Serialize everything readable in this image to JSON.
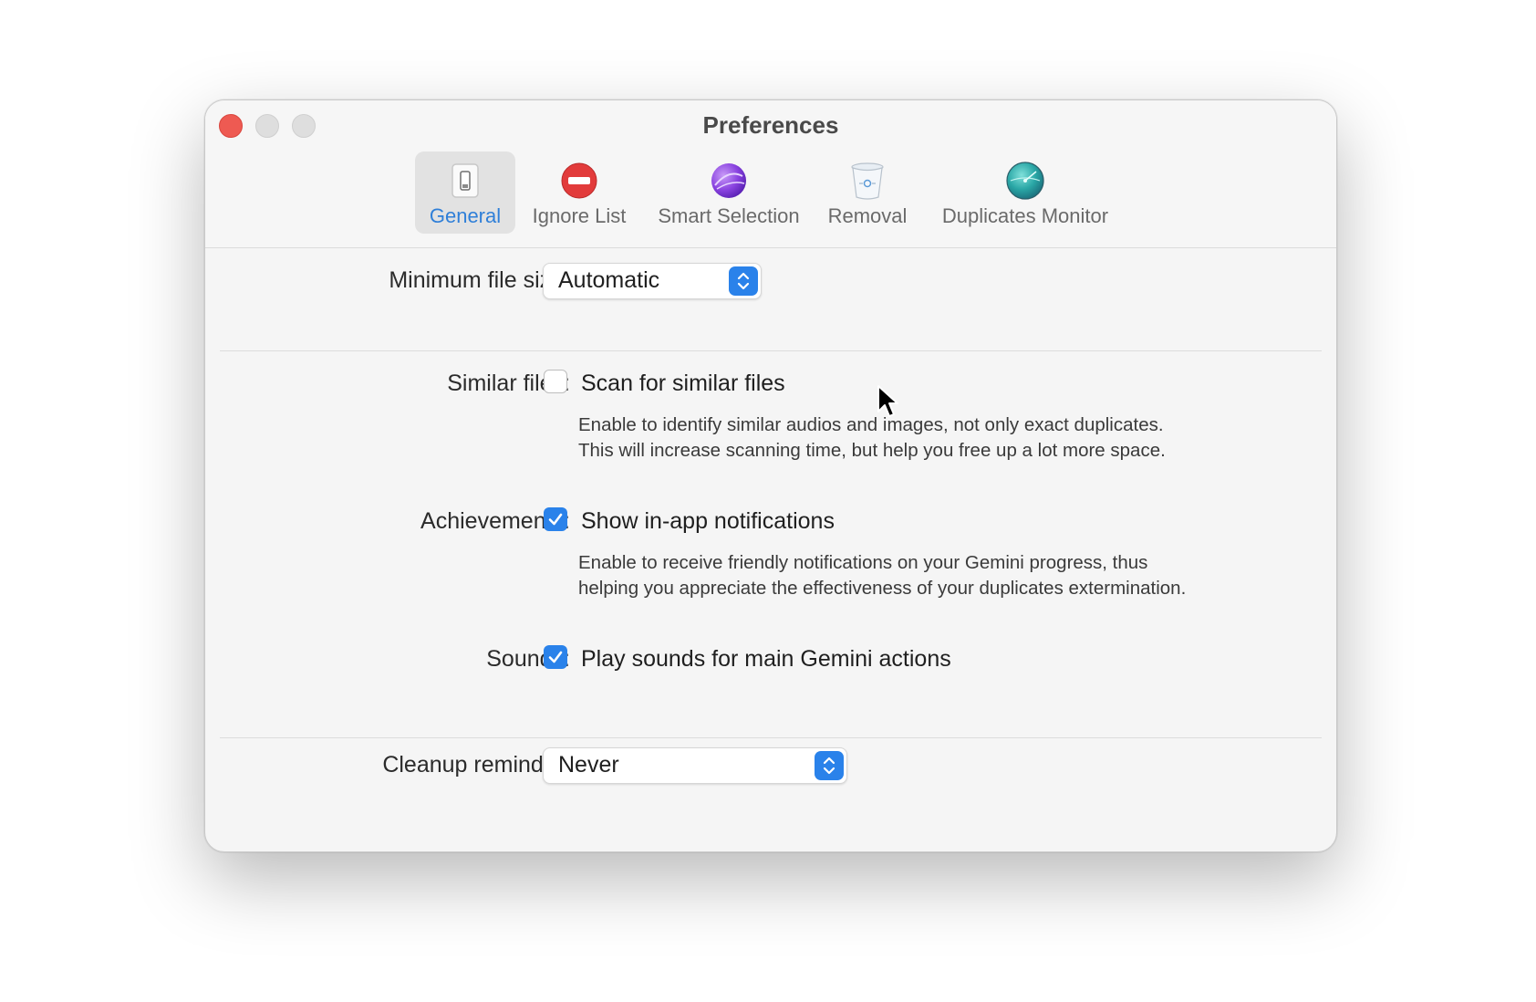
{
  "window": {
    "title": "Preferences"
  },
  "toolbar": {
    "tabs": [
      {
        "label": "General",
        "icon": "general-switch-icon",
        "active": true
      },
      {
        "label": "Ignore List",
        "icon": "no-entry-icon",
        "active": false
      },
      {
        "label": "Smart Selection",
        "icon": "purple-sphere-icon",
        "active": false
      },
      {
        "label": "Removal",
        "icon": "trash-bin-icon",
        "active": false
      },
      {
        "label": "Duplicates Monitor",
        "icon": "radar-globe-icon",
        "active": false
      }
    ]
  },
  "general": {
    "min_file_size": {
      "label": "Minimum file size:",
      "value": "Automatic"
    },
    "similar_files": {
      "label": "Similar files:",
      "checkbox_label": "Scan for similar files",
      "checked": false,
      "description_line1": "Enable to identify similar audios and images, not only exact duplicates.",
      "description_line2": "This will increase scanning time, but help you free up a lot more space."
    },
    "achievements": {
      "label": "Achievements:",
      "checkbox_label": "Show in-app notifications",
      "checked": true,
      "description_line1": "Enable to receive friendly notifications on your Gemini progress, thus",
      "description_line2": "helping you appreciate the effectiveness of your duplicates extermination."
    },
    "sounds": {
      "label": "Sounds:",
      "checkbox_label": "Play sounds for main Gemini actions",
      "checked": true
    },
    "cleanup_reminder": {
      "label": "Cleanup reminder:",
      "value": "Never"
    }
  },
  "colors": {
    "accent": "#2a82ea",
    "active_tab_text": "#2f7fd8",
    "close_button": "#ee5a52"
  }
}
